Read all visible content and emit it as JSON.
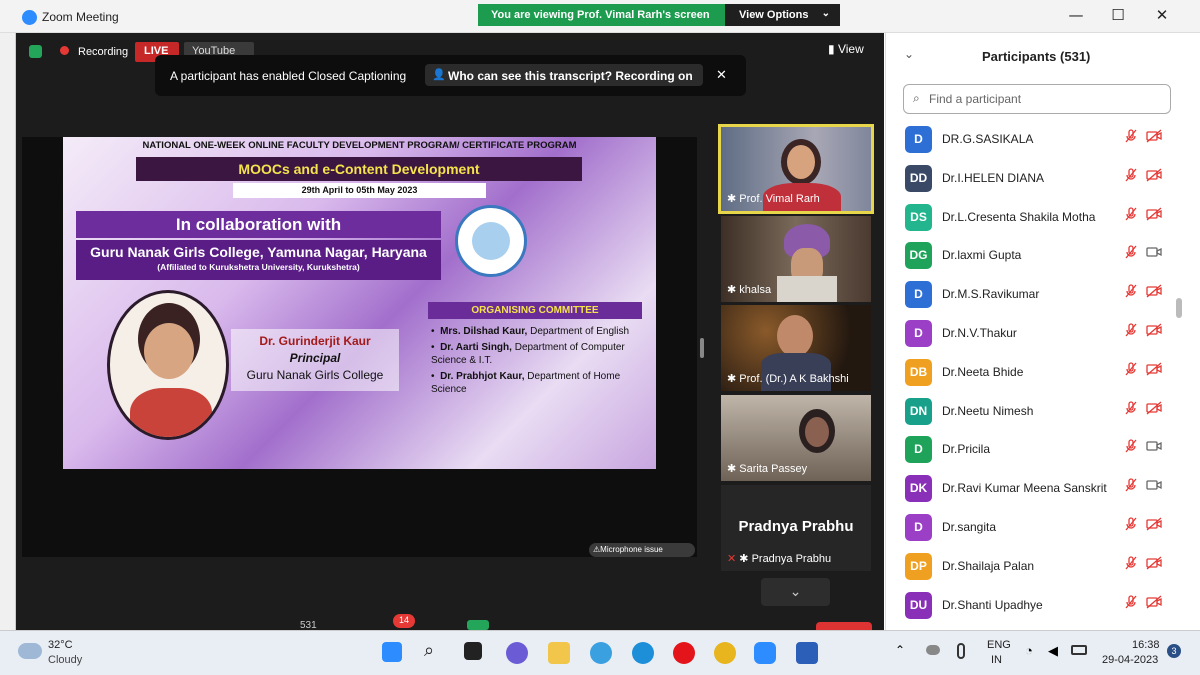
{
  "window": {
    "app_title": "Zoom Meeting",
    "minimize": "—",
    "maximize": "☐",
    "close": "✕"
  },
  "banner": {
    "viewing_text": "You are viewing Prof. Vimal Rarh's screen",
    "view_options": "View Options"
  },
  "meeting_bar": {
    "recording": "Recording",
    "live": "LIVE",
    "youtube": "YouTube",
    "view": "View"
  },
  "cc_notice": {
    "text": "A participant has enabled Closed Captioning",
    "who_can_see": "Who can see this transcript? Recording on",
    "close": "✕"
  },
  "slide": {
    "header": "NATIONAL ONE-WEEK ONLINE FACULTY DEVELOPMENT PROGRAM/ CERTIFICATE PROGRAM",
    "title": "MOOCs and e-Content Development",
    "dates": "29th April to 05th May 2023",
    "collab": "In collaboration with",
    "college": "Guru Nanak Girls College, Yamuna Nagar, Haryana",
    "affiliated": "(Affiliated to Kurukshetra University, Kurukshetra)",
    "person_name": "Dr. Gurinderjit Kaur",
    "person_role": "Principal",
    "person_org": "Guru Nanak Girls College",
    "committee_title": "ORGANISING COMMITTEE",
    "committee": [
      {
        "name": "Mrs. Dilshad Kaur,",
        "dept": " Department of English"
      },
      {
        "name": "Dr. Aarti Singh,",
        "dept": " Department of Computer Science & I.T."
      },
      {
        "name": "Dr. Prabhjot Kaur,",
        "dept": " Department of Home Science"
      }
    ]
  },
  "mic_issue": "⚠Microphone issue",
  "videos": [
    {
      "name": "Prof. Vimal Rarh"
    },
    {
      "name": "khalsa"
    },
    {
      "name": "Prof. (Dr.) A K Bakhshi"
    },
    {
      "name": "Sarita Passey"
    },
    {
      "name": "Pradnya Prabhu",
      "big_name": "Pradnya Prabhu"
    }
  ],
  "toolbar": {
    "participants_count": "531",
    "chat_badge": "14"
  },
  "panel": {
    "title": "Participants (531)",
    "search_placeholder": "Find a participant",
    "participants": [
      {
        "initials": "D",
        "name": "DR.G.SASIKALA",
        "color": "#2e6fd6",
        "cam": "off"
      },
      {
        "initials": "DD",
        "name": "Dr.I.HELEN DIANA",
        "color": "#3a4a66",
        "cam": "off"
      },
      {
        "initials": "DS",
        "name": "Dr.L.Cresenta Shakila Motha",
        "color": "#23b58d",
        "cam": "off"
      },
      {
        "initials": "DG",
        "name": "Dr.laxmi Gupta",
        "color": "#1fa35a",
        "cam": "on"
      },
      {
        "initials": "D",
        "name": "Dr.M.S.Ravikumar",
        "color": "#2e6fd6",
        "cam": "off"
      },
      {
        "initials": "D",
        "name": "Dr.N.V.Thakur",
        "color": "#9b3fc6",
        "cam": "off"
      },
      {
        "initials": "DB",
        "name": "Dr.Neeta Bhide",
        "color": "#f0a020",
        "cam": "off"
      },
      {
        "initials": "DN",
        "name": "Dr.Neetu Nimesh",
        "color": "#18a08a",
        "cam": "off"
      },
      {
        "initials": "D",
        "name": "Dr.Pricila",
        "color": "#1fa35a",
        "cam": "on"
      },
      {
        "initials": "DK",
        "name": "Dr.Ravi Kumar Meena Sanskrit",
        "color": "#8a2fb8",
        "cam": "on"
      },
      {
        "initials": "D",
        "name": "Dr.sangita",
        "color": "#9b3fc6",
        "cam": "off"
      },
      {
        "initials": "DP",
        "name": "Dr.Shailaja Palan",
        "color": "#f0a020",
        "cam": "off"
      },
      {
        "initials": "DU",
        "name": "Dr.Shanti Upadhye",
        "color": "#8a2fb8",
        "cam": "off"
      }
    ]
  },
  "taskbar": {
    "temp": "32°C",
    "weather": "Cloudy",
    "lang1": "ENG",
    "lang2": "IN",
    "time": "16:38",
    "date": "29-04-2023",
    "notif": "3"
  }
}
